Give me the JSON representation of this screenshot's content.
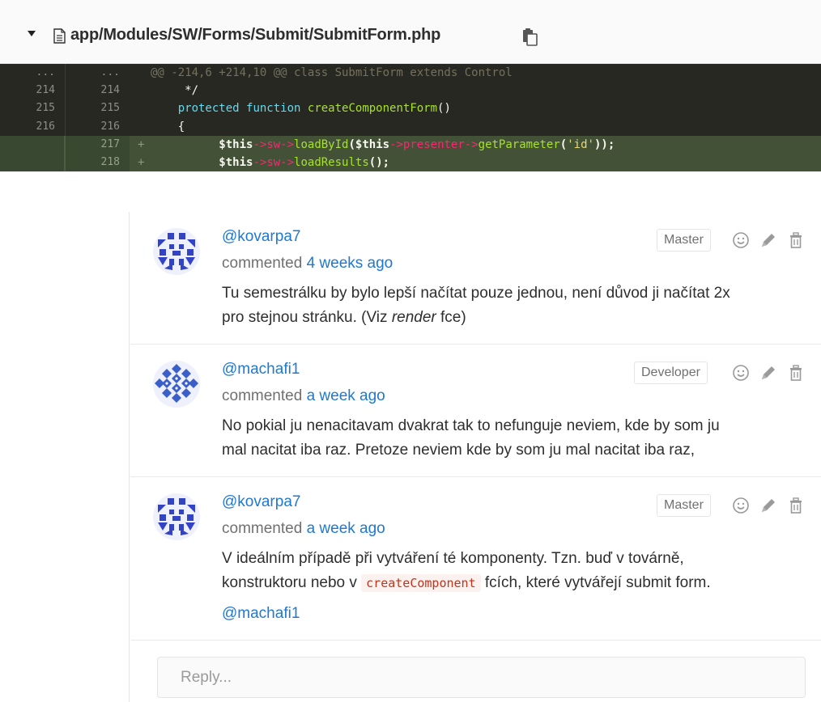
{
  "file": {
    "path": "app/Modules/SW/Forms/Submit/SubmitForm.php"
  },
  "diff": {
    "hunk": "@@ -214,6 +214,10 @@ class SubmitForm extends Control",
    "rows": [
      {
        "old": "...",
        "new": "...",
        "type": "hunk"
      },
      {
        "old": "214",
        "new": "214",
        "type": "context"
      },
      {
        "old": "215",
        "new": "215",
        "type": "context"
      },
      {
        "old": "216",
        "new": "216",
        "type": "context"
      },
      {
        "old": "",
        "new": "217",
        "type": "added"
      },
      {
        "old": "",
        "new": "218",
        "type": "added"
      }
    ],
    "code": {
      "l214": "     */",
      "l215_kw1": "protected",
      "l215_kw2": "function",
      "l215_fn": "createComponentForm",
      "l215_rest": "()",
      "l216": "{",
      "l217": "$this->sw->loadById($this->presenter->getParameter('id'));",
      "l218": "$this->sw->loadResults();"
    }
  },
  "notes": [
    {
      "author": "@kovarpa7",
      "action": "commented",
      "time": "4 weeks ago",
      "role": "Master",
      "body_lines": [
        "Tu semestrálku by bylo lepší načítat pouze jednou, není důvod ji načítat 2x",
        "pro stejnou stránku. (Viz ",
        "render",
        " fce)"
      ]
    },
    {
      "author": "@machafi1",
      "action": "commented",
      "time": "a week ago",
      "role": "Developer",
      "body_lines": [
        "No pokial ju nenacitavam dvakrat tak to nefunguje neviem, kde by som ju",
        "mal nacitat iba raz. Pretoze neviem kde by som ju mal nacitat iba raz,"
      ]
    },
    {
      "author": "@kovarpa7",
      "action": "commented",
      "time": "a week ago",
      "role": "Master",
      "body_lines": [
        "V ideálním případě při vytváření té komponenty. Tzn. buď v továrně,",
        "konstruktoru nebo v ",
        "createComponent",
        " fcích, které vytvářejí submit form."
      ],
      "mention": "@machafi1"
    }
  ],
  "reply": {
    "placeholder": "Reply..."
  },
  "icons": {
    "caret": "caret-down-icon",
    "file": "file-text-icon",
    "copy": "copy-icon",
    "emoji": "smiley-icon",
    "edit": "pencil-icon",
    "delete": "trash-icon"
  },
  "colors": {
    "link": "#1f78d1",
    "diff_context_bg": "#272822",
    "diff_added_bg": "#435237",
    "keyword": "#66d9ef",
    "function": "#a6e22e",
    "operator": "#f92672",
    "string": "#e6db74",
    "inline_code": "#c0341d"
  }
}
